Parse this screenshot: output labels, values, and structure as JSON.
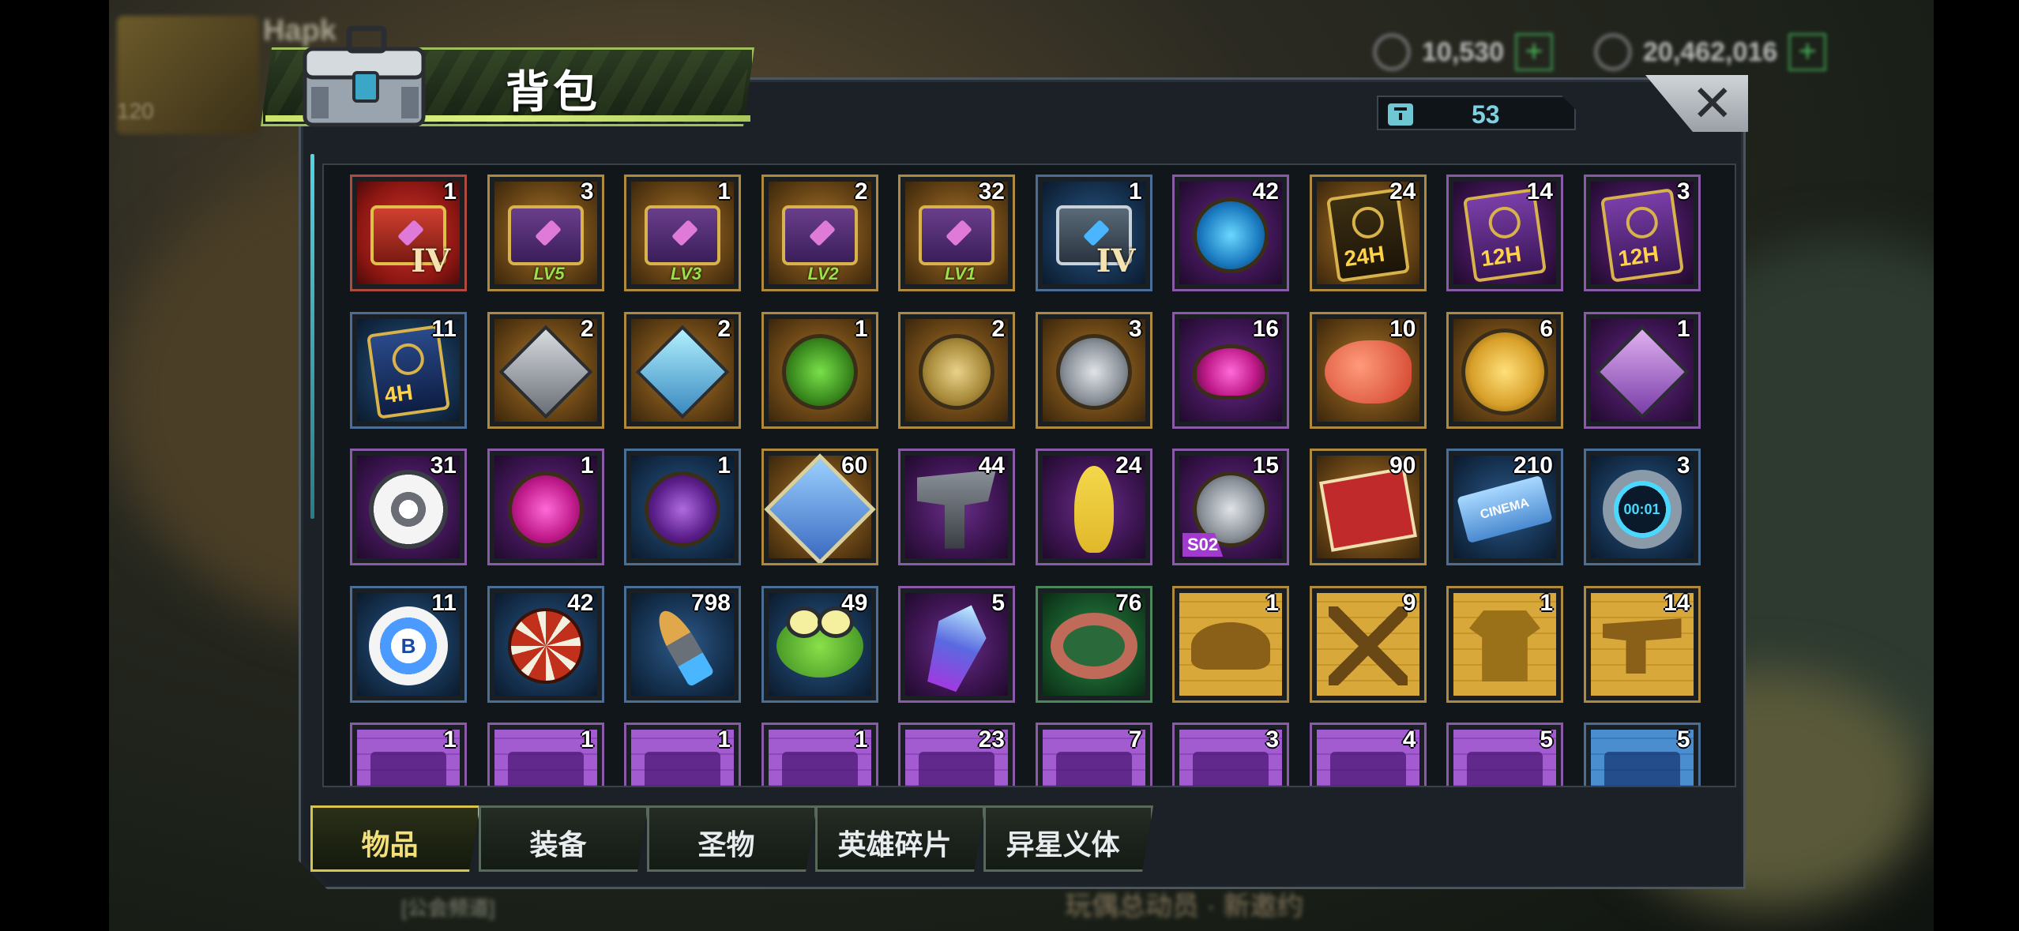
{
  "hud": {
    "player_name": "Hapk",
    "level": "120",
    "resource1": {
      "value": "10,530",
      "plus": "+"
    },
    "resource2": {
      "value": "20,462,016",
      "plus": "+"
    }
  },
  "background_text": {
    "bottom_event": "玩偶总动员 · 新邀约",
    "bottom_left": "[公会频道]"
  },
  "dialog": {
    "title": "背包",
    "close_label": "✕",
    "capacity": "53",
    "tabs": [
      {
        "label": "物品",
        "active": true
      },
      {
        "label": "装备",
        "active": false
      },
      {
        "label": "圣物",
        "active": false
      },
      {
        "label": "英雄碎片",
        "active": false
      },
      {
        "label": "异星义体",
        "active": false
      }
    ]
  },
  "inventory": {
    "rows": [
      [
        {
          "icon": "red-chest-icon",
          "count": "1",
          "tag": "IV"
        },
        {
          "icon": "purple-chest-icon",
          "count": "3",
          "tag": "LV5"
        },
        {
          "icon": "purple-chest-icon",
          "count": "1",
          "tag": "LV3"
        },
        {
          "icon": "purple-chest-icon",
          "count": "2",
          "tag": "LV2"
        },
        {
          "icon": "purple-chest-icon",
          "count": "32",
          "tag": "LV1"
        },
        {
          "icon": "silver-chest-icon",
          "count": "1",
          "tag": "IV"
        },
        {
          "icon": "speedup-device-icon",
          "count": "42"
        },
        {
          "icon": "gold-card-24h-icon",
          "count": "24",
          "tag": "24H"
        },
        {
          "icon": "purple-card-12h-icon",
          "count": "14",
          "tag": "12H"
        },
        {
          "icon": "purple-card-12h-icon",
          "count": "3",
          "tag": "12H"
        }
      ],
      [
        {
          "icon": "blue-card-4h-icon",
          "count": "11",
          "tag": "4H"
        },
        {
          "icon": "silver-cube-icon",
          "count": "2"
        },
        {
          "icon": "crystal-cube-icon",
          "count": "2"
        },
        {
          "icon": "green-emblem-icon",
          "count": "1"
        },
        {
          "icon": "gold-coin-icon",
          "count": "2"
        },
        {
          "icon": "silver-emblem-icon",
          "count": "3"
        },
        {
          "icon": "pink-lips-icon",
          "count": "16"
        },
        {
          "icon": "goldfish-icon",
          "count": "10"
        },
        {
          "icon": "dragon-coin-icon",
          "count": "6"
        },
        {
          "icon": "purple-cube-icon",
          "count": "1"
        }
      ],
      [
        {
          "icon": "film-reel-icon",
          "count": "31"
        },
        {
          "icon": "pink-bottle-cap-icon",
          "count": "1"
        },
        {
          "icon": "spade-chip-icon",
          "count": "1"
        },
        {
          "icon": "police-badge-icon",
          "count": "60"
        },
        {
          "icon": "fish-statue-icon",
          "count": "44"
        },
        {
          "icon": "banana-icon",
          "count": "24"
        },
        {
          "icon": "silver-token-icon",
          "count": "15",
          "tag": "S02"
        },
        {
          "icon": "poster-icon",
          "count": "90"
        },
        {
          "icon": "cinema-ticket-icon",
          "count": "210",
          "tag": "CINEMA"
        },
        {
          "icon": "timer-icon",
          "count": "3",
          "tag": "00:01"
        }
      ],
      [
        {
          "icon": "blue-bottle-cap-icon",
          "count": "11",
          "tag": "B"
        },
        {
          "icon": "red-poker-chip-icon",
          "count": "42"
        },
        {
          "icon": "bullet-icon",
          "count": "798"
        },
        {
          "icon": "frog-hat-icon",
          "count": "49"
        },
        {
          "icon": "crystal-shard-icon",
          "count": "5"
        },
        {
          "icon": "tentacle-ring-icon",
          "count": "76"
        },
        {
          "icon": "cowboy-hat-blueprint-icon",
          "count": "1"
        },
        {
          "icon": "crossed-swords-blueprint-icon",
          "count": "9"
        },
        {
          "icon": "shirt-blueprint-icon",
          "count": "1"
        },
        {
          "icon": "revolver-blueprint-icon",
          "count": "14"
        }
      ],
      [
        {
          "icon": "purple-blueprint-icon",
          "count": "1"
        },
        {
          "icon": "purple-blueprint-icon",
          "count": "1"
        },
        {
          "icon": "purple-blueprint-icon",
          "count": "1"
        },
        {
          "icon": "purple-blueprint-icon",
          "count": "1"
        },
        {
          "icon": "purple-blueprint-icon",
          "count": "23"
        },
        {
          "icon": "purple-blueprint-icon",
          "count": "7"
        },
        {
          "icon": "purple-blueprint-icon",
          "count": "3"
        },
        {
          "icon": "purple-blueprint-icon",
          "count": "4"
        },
        {
          "icon": "purple-blueprint-icon",
          "count": "5"
        },
        {
          "icon": "blue-blueprint-icon",
          "count": "5"
        }
      ]
    ]
  }
}
